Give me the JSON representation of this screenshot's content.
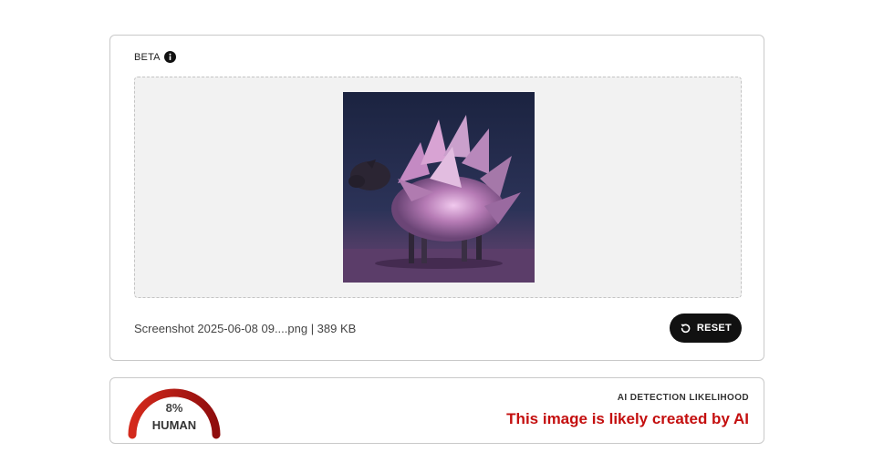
{
  "upload": {
    "badge": "BETA",
    "info_icon": "info-icon",
    "preview_description": "sheep-like creature made of pink crystal shards",
    "file_info": "Screenshot 2025-06-08 09....png | 389 KB",
    "reset_label": "RESET",
    "reset_icon": "rotate-left-icon"
  },
  "result": {
    "percentage": "8%",
    "percentage_value": 0.08,
    "label": "HUMAN",
    "title": "AI DETECTION LIKELIHOOD",
    "verdict": "This image is likely created by AI"
  },
  "colors": {
    "verdict": "#c40f0f",
    "gauge_start": "#d42a1c",
    "gauge_end": "#8f0d0d",
    "reset_bg": "#111111"
  }
}
